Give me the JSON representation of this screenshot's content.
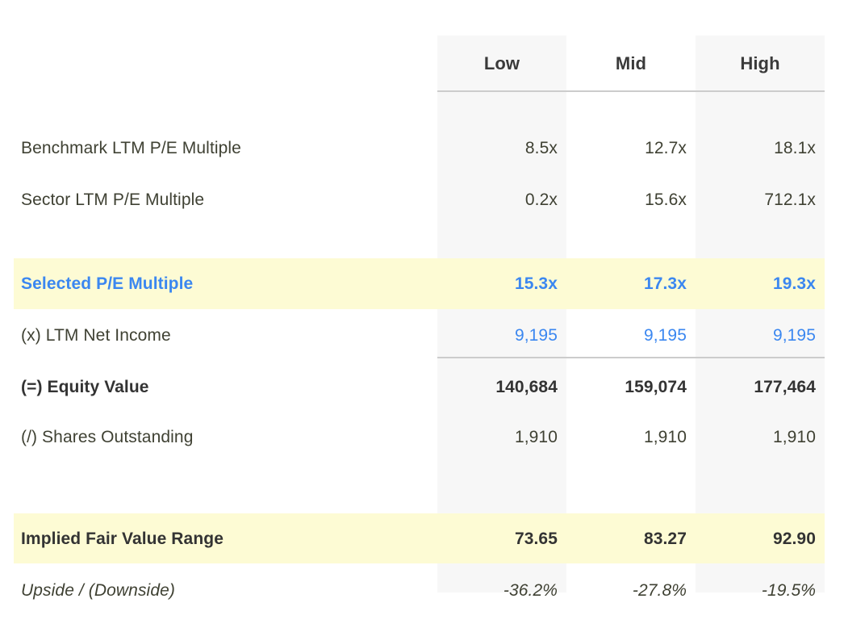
{
  "table": {
    "columns": [
      "Low",
      "Mid",
      "High"
    ],
    "row_label_header": "",
    "rows": [
      {
        "key": "benchmark",
        "label": "Benchmark LTM P/E Multiple",
        "values": [
          "8.5x",
          "12.7x",
          "18.1x"
        ],
        "style": "normal"
      },
      {
        "key": "sector",
        "label": "Sector LTM P/E Multiple",
        "values": [
          "0.2x",
          "15.6x",
          "712.1x"
        ],
        "style": "normal"
      },
      {
        "key": "selected",
        "label": "Selected P/E Multiple",
        "values": [
          "15.3x",
          "17.3x",
          "19.3x"
        ],
        "style": "highlight-blue-bold"
      },
      {
        "key": "netincome",
        "label": "(x) LTM Net Income",
        "values": [
          "9,195",
          "9,195",
          "9,195"
        ],
        "style": "blue"
      },
      {
        "key": "equity",
        "label": "(=) Equity Value",
        "values": [
          "140,684",
          "159,074",
          "177,464"
        ],
        "style": "bold"
      },
      {
        "key": "shares",
        "label": "(/) Shares Outstanding",
        "values": [
          "1,910",
          "1,910",
          "1,910"
        ],
        "style": "normal"
      },
      {
        "key": "implied",
        "label": "Implied Fair Value Range",
        "values": [
          "73.65",
          "83.27",
          "92.90"
        ],
        "style": "highlight-bold"
      },
      {
        "key": "upside",
        "label": "Upside / (Downside)",
        "values": [
          "-36.2%",
          "-27.8%",
          "-19.5%"
        ],
        "style": "italic"
      }
    ],
    "colors": {
      "stripe": "#f7f7f7",
      "highlight": "#fdfbd4",
      "accent_blue": "#3b87f0",
      "text": "#3f4133",
      "divider": "#cccccc"
    }
  }
}
